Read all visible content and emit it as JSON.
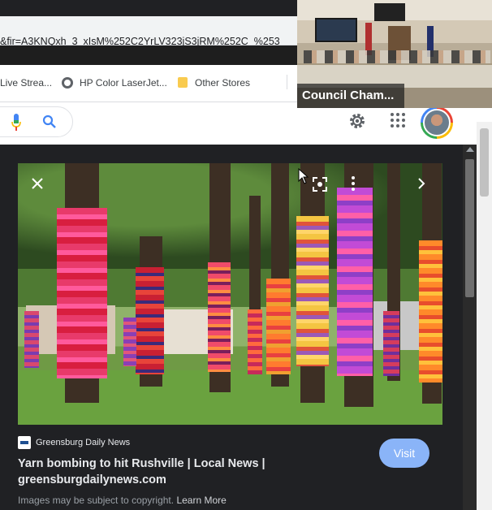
{
  "browser": {
    "url_text": "&fir=A3KNQxh_3_xIsM%252C2YrLV323jS3jRM%252C_%253",
    "bookmarks": {
      "live": "Live Strea...",
      "hp": "HP Color LaserJet...",
      "other": "Other Stores"
    }
  },
  "video": {
    "label": "Council Cham..."
  },
  "header": {
    "icons": [
      "microphone-icon",
      "google-lens-icon",
      "gear-icon",
      "apps-grid-icon"
    ]
  },
  "preview": {
    "source": "Greensburg Daily News",
    "title_line1": "Yarn bombing to hit Rushville | Local News |",
    "title_line2": "greensburgdailynews.com",
    "visit_label": "Visit",
    "copyright_text": "Images may be subject to copyright.",
    "learn_more": "Learn More"
  },
  "colors": {
    "panel_bg": "#202124",
    "visit_button": "#8ab4f8"
  }
}
